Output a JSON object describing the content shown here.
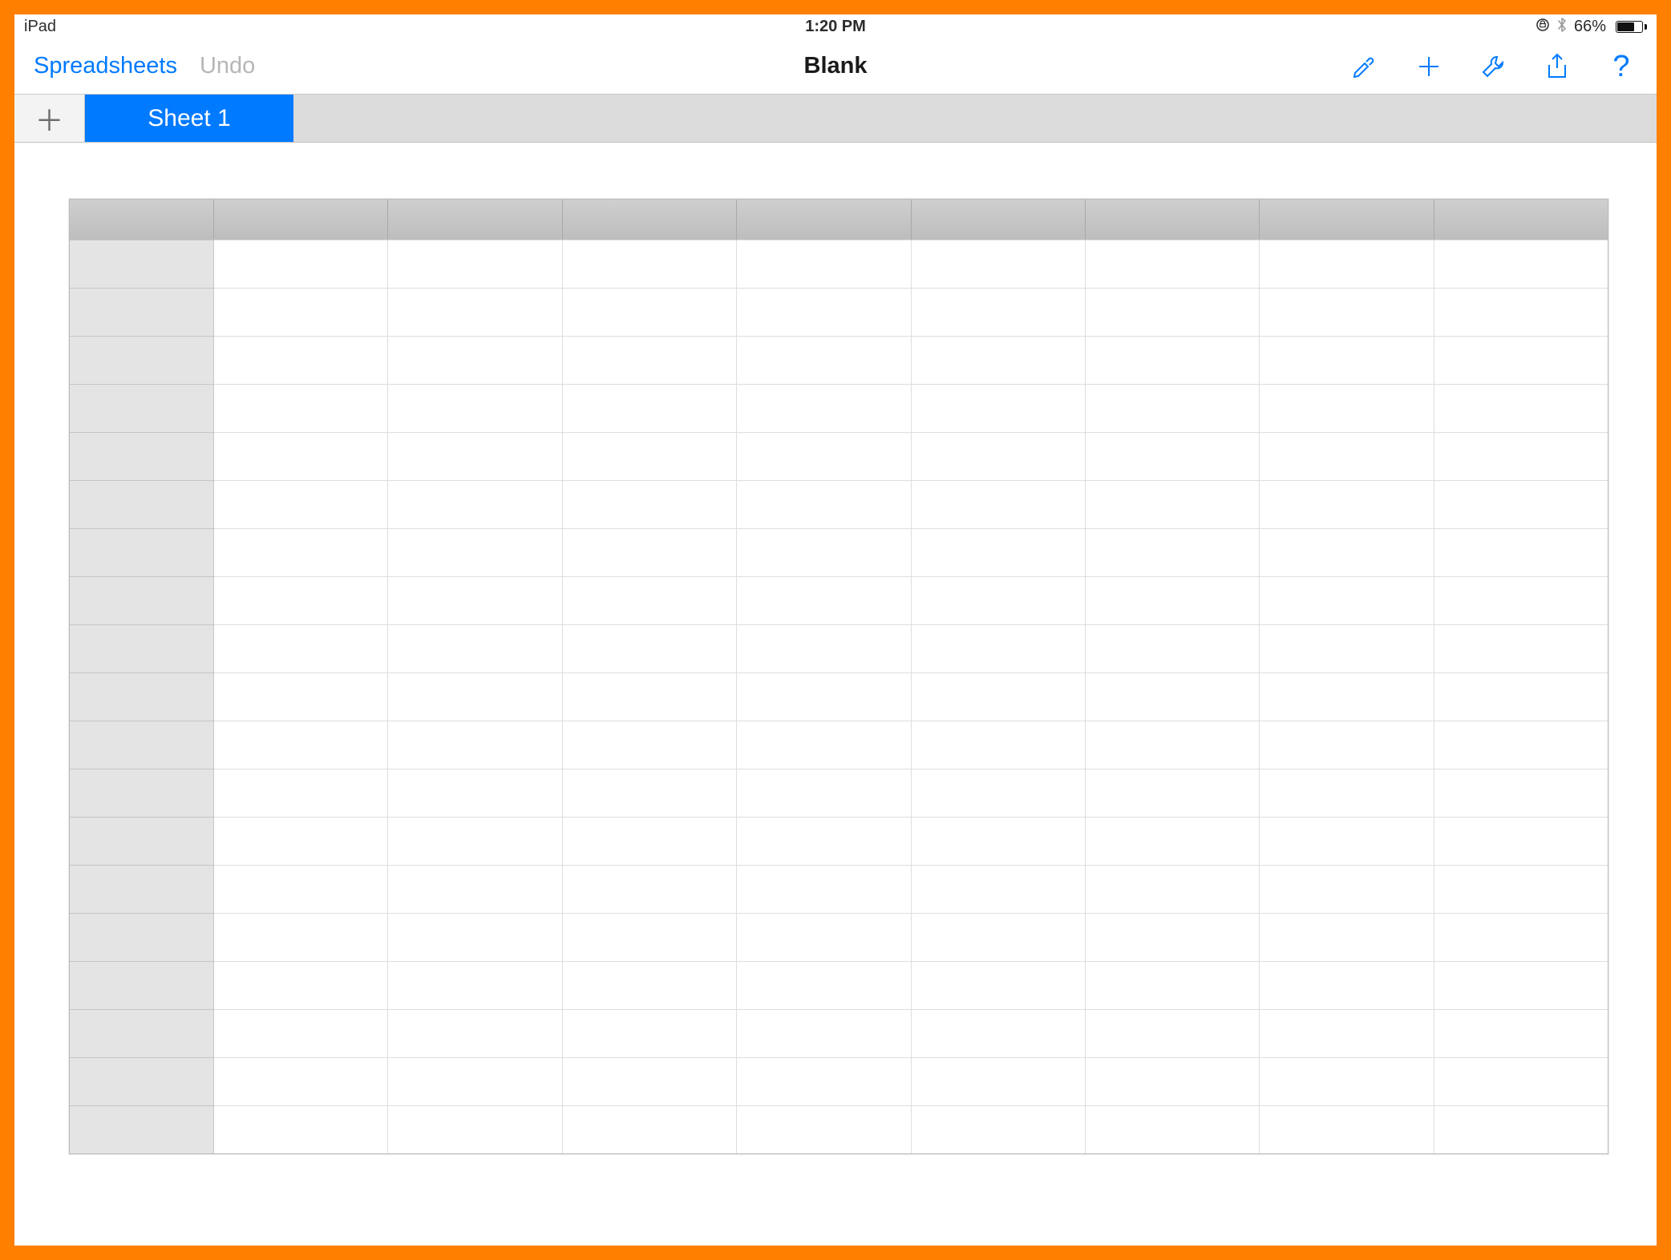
{
  "statusbar": {
    "device": "iPad",
    "time": "1:20 PM",
    "battery_pct": "66%",
    "orientation_lock_glyph": "⊕",
    "bluetooth_glyph": "⁂"
  },
  "toolbar": {
    "back_label": "Spreadsheets",
    "undo_label": "Undo",
    "title": "Blank"
  },
  "tabs": {
    "add_glyph": "＋",
    "items": [
      {
        "label": "Sheet 1",
        "active": true
      }
    ]
  },
  "grid": {
    "columns": 8,
    "rows": 19
  },
  "colors": {
    "accent": "#007aff",
    "frame": "#ff7f00"
  }
}
